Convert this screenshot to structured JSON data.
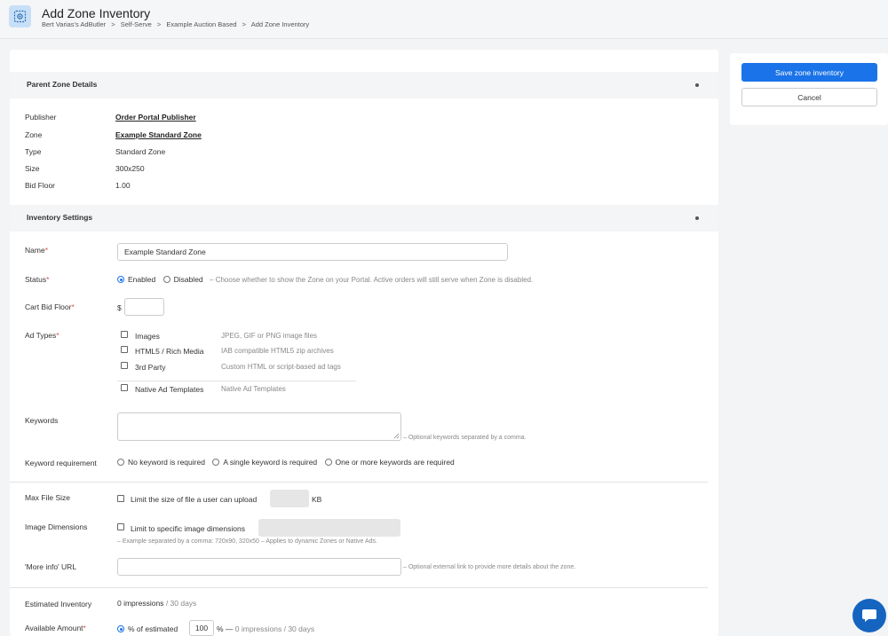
{
  "header": {
    "title": "Add Zone Inventory",
    "breadcrumb": [
      "Bert Varias's AdButler",
      ">",
      "Self-Serve",
      ">",
      "Example Auction Based",
      ">",
      "Add Zone Inventory"
    ]
  },
  "parent_zone": {
    "title": "Parent Zone Details",
    "fields": [
      {
        "label": "Publisher",
        "value": "Order Portal Publisher"
      },
      {
        "label": "Zone",
        "value": "Example Standard Zone"
      },
      {
        "label": "Type",
        "value": "Standard Zone"
      },
      {
        "label": "Size",
        "value": "300x250"
      },
      {
        "label": "Bid Floor",
        "value": "1.00"
      }
    ]
  },
  "inventory": {
    "title": "Inventory Settings",
    "required_mark": "*",
    "name": {
      "label": "Name",
      "value": "Example Standard Zone"
    },
    "status": {
      "label": "Status",
      "enabled": "Enabled",
      "disabled": "Disabled",
      "hint": "– Choose whether to show the Zone on your Portal. Active orders will still serve when Zone is disabled."
    },
    "cart_bid_floor": {
      "label": "Cart Bid Floor",
      "currency": "$",
      "value": ""
    },
    "ad_types": {
      "label": "Ad Types",
      "options": [
        {
          "name": "Images",
          "desc": "JPEG, GIF or PNG image files"
        },
        {
          "name": "HTML5 / Rich Media",
          "desc": "IAB compatible HTML5 zip archives"
        },
        {
          "name": "3rd Party",
          "desc": "Custom HTML or script-based ad tags"
        },
        {
          "name": "Native Ad Templates",
          "desc": "Native Ad Templates"
        }
      ]
    },
    "keywords": {
      "label": "Keywords",
      "value": "",
      "hint": "– Optional keywords separated by a comma."
    },
    "keyword_requirement": {
      "label": "Keyword requirement",
      "options": [
        "No keyword is required",
        "A single keyword is required",
        "One or more keywords are required"
      ]
    },
    "max_file_size": {
      "label": "Max File Size",
      "checkbox": "Limit the size of file a user can upload",
      "unit": "KB"
    },
    "image_dimensions": {
      "label": "Image Dimensions",
      "checkbox": "Limit to specific image dimensions",
      "hint": "– Example separated by a comma: 720x90, 320x50 – Applies to dynamic Zones or Native Ads."
    },
    "more_info": {
      "label": "'More info' URL",
      "value": "",
      "hint": "– Optional external link to provide more details about the zone."
    },
    "estimated": {
      "label": "Estimated Inventory",
      "impressions": "0 impressions",
      "period": "/ 30 days"
    },
    "available": {
      "label": "Available Amount",
      "option": "% of estimated",
      "percent": "100",
      "suffix": "% —",
      "detail": "0 impressions / 30 days"
    }
  },
  "actions": {
    "save": "Save zone inventory",
    "cancel": "Cancel"
  },
  "colors": {
    "primary": "#1a73e8",
    "required": "#d9534f",
    "chat": "#1565c0"
  }
}
